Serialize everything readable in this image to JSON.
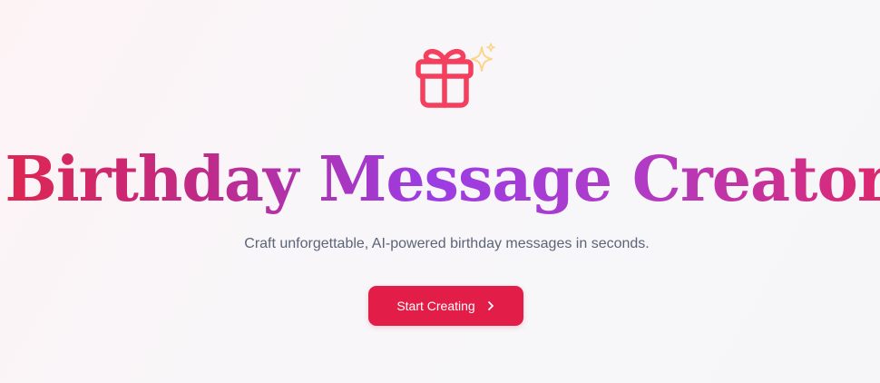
{
  "hero": {
    "title": "Birthday Message Creator",
    "subtitle": "Craft unforgettable, AI-powered birthday messages in seconds.",
    "cta_label": "Start Creating",
    "icons": {
      "main": "gift-icon",
      "accent": "sparkle-icon",
      "cta": "chevron-right-icon"
    }
  },
  "colors": {
    "accent": "#e11d48",
    "gift": "#f43f5e",
    "sparkle": "#fcd58a",
    "subtitle": "#5b6478",
    "title_gradient": [
      "#e0264f",
      "#c02a86",
      "#9b3de4",
      "#b13bc4",
      "#e0266a"
    ]
  }
}
